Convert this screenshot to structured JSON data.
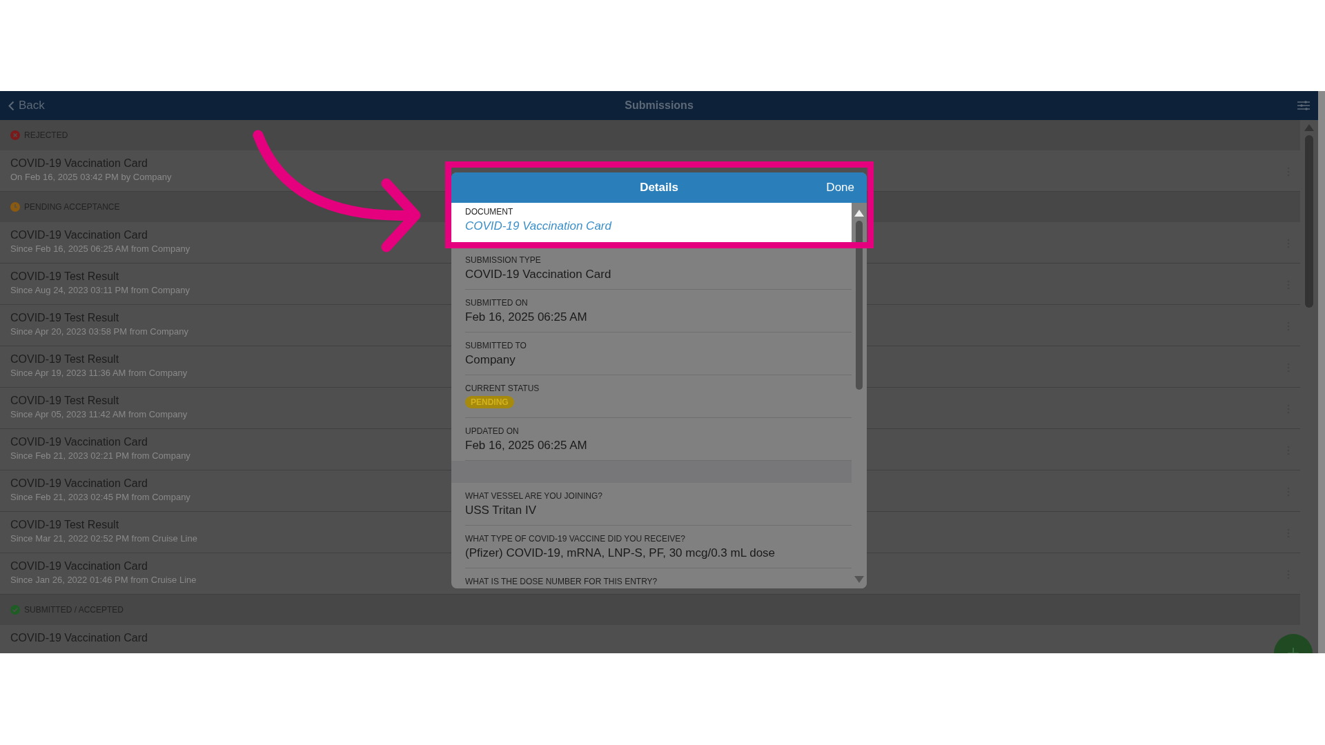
{
  "header": {
    "back": "Back",
    "title": "Submissions"
  },
  "sections": [
    {
      "kind": "rejected",
      "title": "REJECTED",
      "items": [
        {
          "title": "COVID-19 Vaccination Card",
          "subtitle": "On Feb 16, 2025 03:42 PM by Company"
        }
      ]
    },
    {
      "kind": "pending",
      "title": "PENDING ACCEPTANCE",
      "items": [
        {
          "title": "COVID-19 Vaccination Card",
          "subtitle": "Since Feb 16, 2025 06:25 AM from Company"
        },
        {
          "title": "COVID-19 Test Result",
          "subtitle": "Since Aug 24, 2023 03:11 PM from Company"
        },
        {
          "title": "COVID-19 Test Result",
          "subtitle": "Since Apr 20, 2023 03:58 PM from Company"
        },
        {
          "title": "COVID-19 Test Result",
          "subtitle": "Since Apr 19, 2023 11:36 AM from Company"
        },
        {
          "title": "COVID-19 Test Result",
          "subtitle": "Since Apr 05, 2023 11:42 AM from Company"
        },
        {
          "title": "COVID-19 Vaccination Card",
          "subtitle": "Since Feb 21, 2023 02:21 PM from Company"
        },
        {
          "title": "COVID-19 Vaccination Card",
          "subtitle": "Since Feb 21, 2023 02:45 PM from Company"
        },
        {
          "title": "COVID-19 Test Result",
          "subtitle": "Since Mar 21, 2022 02:52 PM from Cruise Line"
        },
        {
          "title": "COVID-19 Vaccination Card",
          "subtitle": "Since Jan 26, 2022 01:46 PM from Cruise Line"
        }
      ]
    },
    {
      "kind": "accepted",
      "title": "SUBMITTED / ACCEPTED",
      "items": [
        {
          "title": "COVID-19 Vaccination Card"
        }
      ]
    }
  ],
  "details": {
    "title": "Details",
    "done": "Done",
    "document": {
      "label": "DOCUMENT",
      "value": "COVID-19 Vaccination Card"
    },
    "fields": [
      {
        "kind": "text",
        "label": "SUBMISSION TYPE",
        "value": "COVID-19 Vaccination Card"
      },
      {
        "kind": "text",
        "label": "SUBMITTED ON",
        "value": "Feb 16, 2025 06:25 AM"
      },
      {
        "kind": "text",
        "label": "SUBMITTED TO",
        "value": "Company"
      },
      {
        "kind": "badge",
        "label": "CURRENT STATUS",
        "value": "PENDING"
      },
      {
        "kind": "text",
        "label": "UPDATED ON",
        "value": "Feb 16, 2025 06:25 AM"
      }
    ],
    "answers": [
      {
        "label": "WHAT VESSEL ARE YOU JOINING?",
        "value": "USS Tritan IV"
      },
      {
        "label": "WHAT TYPE OF COVID-19 VACCINE DID YOU RECEIVE?",
        "value": "(Pfizer) COVID-19, mRNA, LNP-S, PF, 30 mcg/0.3 mL dose"
      },
      {
        "label": "WHAT IS THE DOSE NUMBER FOR THIS ENTRY?"
      }
    ]
  }
}
